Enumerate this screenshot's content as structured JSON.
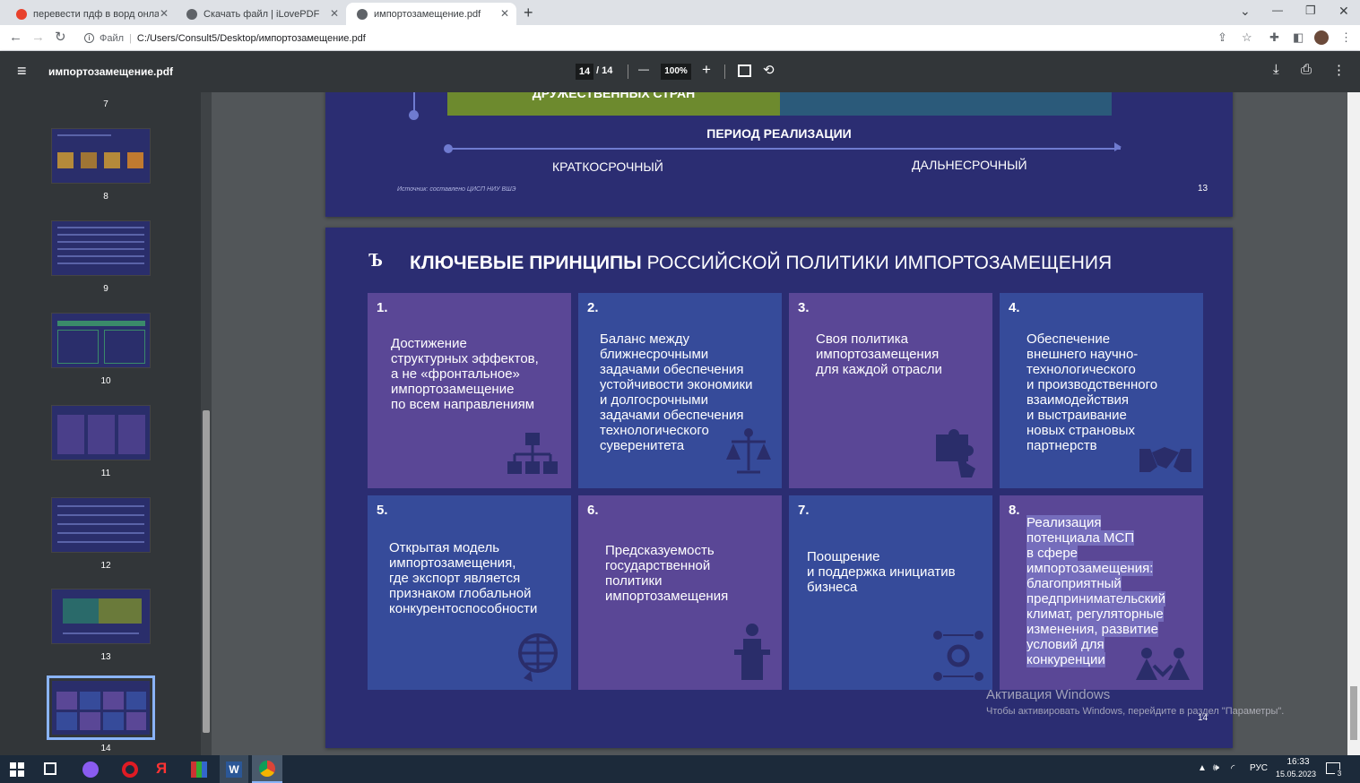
{
  "tabs": [
    {
      "title": "перевести пдф в ворд онлайн б",
      "close": "✕",
      "color": "#e8412c"
    },
    {
      "title": "Скачать файл | iLovePDF",
      "close": "✕",
      "color": "#5f6368"
    },
    {
      "title": "импортозамещение.pdf",
      "close": "✕",
      "color": "#5f6368"
    }
  ],
  "new_tab": "+",
  "window_controls": {
    "dropdown": "⌄",
    "minimize": "—",
    "restore": "❐",
    "close": "✕"
  },
  "address": {
    "scheme_label": "Файл",
    "url": "C:/Users/Consult5/Desktop/импортозамещение.pdf"
  },
  "pdf_toolbar": {
    "menu": "≡",
    "file_name": "импортозамещение.pdf",
    "page_current": "14",
    "page_total": "/ 14",
    "zoom_out": "—",
    "zoom": "100%",
    "zoom_in": "+"
  },
  "thumbnails": [
    "7",
    "8",
    "9",
    "10",
    "11",
    "12",
    "13",
    "14"
  ],
  "slide13": {
    "banner": "ДРУЖЕСТВЕННЫХ СТРАН",
    "period_label": "ПЕРИОД РЕАЛИЗАЦИИ",
    "short_term": "КРАТКОСРОЧНЫЙ",
    "long_term": "ДАЛЬНЕСРОЧНЫЙ",
    "source": "Источник: составлено ЦИСП НИУ ВШЭ",
    "page": "13"
  },
  "slide14": {
    "logo": "Ъ",
    "title_bold": "КЛЮЧЕВЫЕ ПРИНЦИПЫ",
    "title_rest": "РОССИЙСКОЙ ПОЛИТИКИ ИМПОРТОЗАМЕЩЕНИЯ",
    "cards": [
      {
        "num": "1.",
        "text": "Достижение\nструктурных эффектов,\nа не «фронтальное»\nимпортозамещение\nпо всем направлениям"
      },
      {
        "num": "2.",
        "text": "Баланс между\nближнесрочными\nзадачами обеспечения\nустойчивости экономики\nи долгосрочными\nзадачами обеспечения\nтехнологического\nсуверенитета"
      },
      {
        "num": "3.",
        "text": "Своя политика\nимпортозамещения\nдля каждой отрасли"
      },
      {
        "num": "4.",
        "text": "Обеспечение\nвнешнего научно-\nтехнологического\nи производственного\nвзаимодействия\nи выстраивание\nновых страновых\nпартнерств"
      },
      {
        "num": "5.",
        "text": "Открытая модель\nимпортозамещения,\nгде экспорт является\nпризнаком глобальной\nконкурентоспособности"
      },
      {
        "num": "6.",
        "text": "Предсказуемость\nгосударственной\nполитики\nимпортозамещения"
      },
      {
        "num": "7.",
        "text": "Поощрение\nи поддержка инициатив\nбизнеса"
      },
      {
        "num": "8.",
        "text": "Реализация\nпотенциала МСП\nв сфере\nимпортозамещения:\nблагоприятный\nпредпринимательский\nклимат, регуляторные\nизменения, развитие\nусловий для\nконкуренции"
      }
    ],
    "page": "14"
  },
  "watermark": {
    "title": "Активация Windows",
    "subtitle": "Чтобы активировать Windows, перейдите в раздел \"Параметры\"."
  },
  "taskbar": {
    "lang": "РУС",
    "time": "16:33",
    "date": "15.05.2023",
    "notif": "3"
  }
}
